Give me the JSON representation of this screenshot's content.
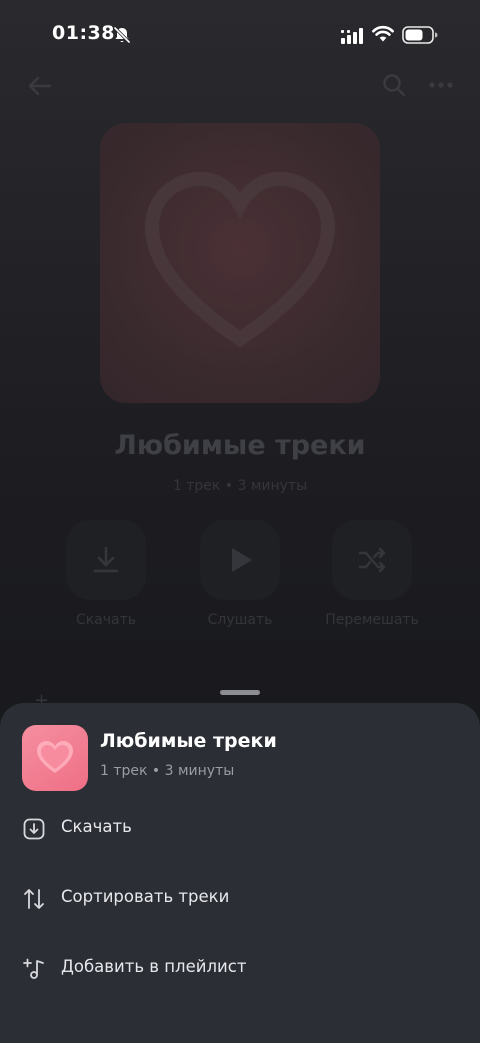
{
  "status_bar": {
    "time": "01:38"
  },
  "background_page": {
    "title": "Любимые треки",
    "subtitle": "1 трек • 3 минуты",
    "actions": [
      {
        "label": "Скачать",
        "icon": "download-icon"
      },
      {
        "label": "Слушать",
        "icon": "play-icon"
      },
      {
        "label": "Перемешать",
        "icon": "shuffle-icon"
      }
    ]
  },
  "sheet": {
    "title": "Любимые треки",
    "subtitle": "1 трек • 3 минуты",
    "cover_color": "#f07a8e",
    "menu": [
      {
        "label": "Скачать",
        "icon": "download-icon"
      },
      {
        "label": "Сортировать треки",
        "icon": "sort-icon"
      },
      {
        "label": "Добавить в плейлист",
        "icon": "add-to-playlist-icon"
      }
    ]
  }
}
